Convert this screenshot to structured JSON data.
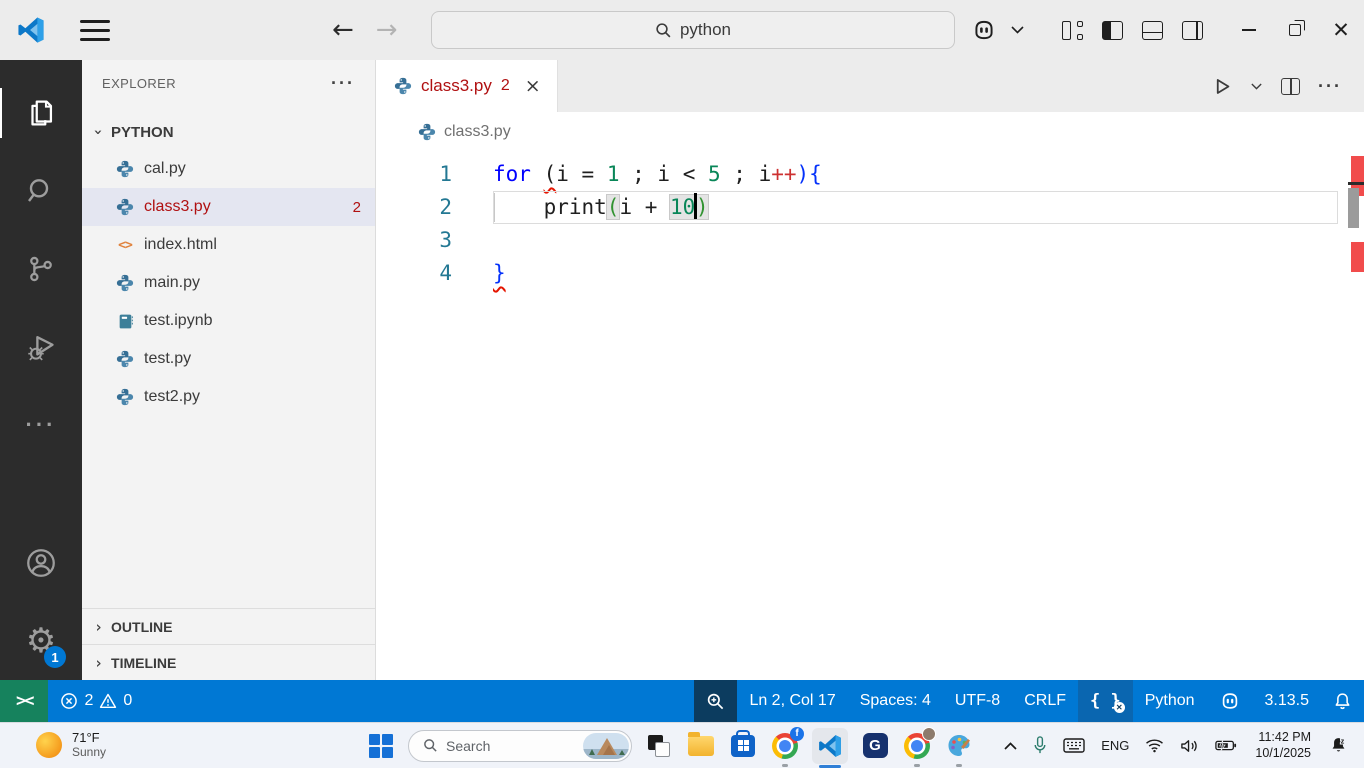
{
  "window": {
    "command_center_value": "python",
    "menu_icon": "hamburger-icon",
    "controls": [
      "minimize",
      "restore",
      "close"
    ]
  },
  "activity_bar": {
    "items": [
      {
        "id": "explorer",
        "icon": "files-icon",
        "active": true
      },
      {
        "id": "search",
        "icon": "search-icon",
        "active": false
      },
      {
        "id": "source-control",
        "icon": "source-control-icon",
        "active": false
      },
      {
        "id": "run-debug",
        "icon": "debug-icon",
        "active": false
      },
      {
        "id": "more-views",
        "icon": "ellipsis-icon",
        "active": false
      }
    ],
    "bottom": [
      {
        "id": "accounts",
        "icon": "account-icon"
      },
      {
        "id": "settings",
        "icon": "gear-icon",
        "badge": "1"
      }
    ]
  },
  "sidebar": {
    "title": "EXPLORER",
    "more_label": "···",
    "folder": "PYTHON",
    "files": [
      {
        "name": "cal.py",
        "icon": "python-icon"
      },
      {
        "name": "class3.py",
        "icon": "python-icon",
        "badge": "2",
        "selected": true,
        "error": true
      },
      {
        "name": "index.html",
        "icon": "html-icon"
      },
      {
        "name": "main.py",
        "icon": "python-icon"
      },
      {
        "name": "test.ipynb",
        "icon": "notebook-icon"
      },
      {
        "name": "test.py",
        "icon": "python-icon"
      },
      {
        "name": "test2.py",
        "icon": "python-icon"
      }
    ],
    "sections": [
      "OUTLINE",
      "TIMELINE"
    ]
  },
  "editor": {
    "tab": {
      "label": "class3.py",
      "badge": "2",
      "close": "×"
    },
    "breadcrumb": "class3.py",
    "code": {
      "lines": [
        {
          "num": "1",
          "tokens": [
            [
              "for",
              "kw"
            ],
            [
              " ",
              "pl"
            ],
            [
              "(",
              "pl sq"
            ],
            [
              "i = ",
              "pl"
            ],
            [
              "1",
              "num"
            ],
            [
              " ; i < ",
              "pl"
            ],
            [
              "5",
              "num"
            ],
            [
              " ; i",
              "pl"
            ],
            [
              "++",
              "red"
            ],
            [
              "){",
              "blue"
            ]
          ]
        },
        {
          "num": "2",
          "current": true,
          "tokens": [
            [
              "    print",
              "pl"
            ],
            [
              "(",
              "grn mt"
            ],
            [
              "i + ",
              "pl"
            ],
            [
              "10",
              "num mt"
            ],
            [
              "",
              "cursor"
            ],
            [
              ")",
              "grn mt"
            ]
          ]
        },
        {
          "num": "3",
          "tokens": []
        },
        {
          "num": "4",
          "tokens": [
            [
              "}",
              "blue sq"
            ]
          ]
        }
      ]
    }
  },
  "status_bar": {
    "errors": "2",
    "warnings": "0",
    "line_col": "Ln 2, Col 17",
    "indentation": "Spaces: 4",
    "encoding": "UTF-8",
    "eol": "CRLF",
    "language": "Python",
    "interpreter": "3.13.5"
  },
  "taskbar": {
    "weather_temp": "71°F",
    "weather_condition": "Sunny",
    "search_label": "Search",
    "app_g_label": "G",
    "tray": {
      "language": "ENG",
      "time": "11:42 PM",
      "date": "10/1/2025"
    }
  },
  "colors": {
    "accent_blue": "#0078d4",
    "remote_green": "#16825d",
    "error_red": "#b01011",
    "activity_bar_bg": "#2c2c2c"
  }
}
